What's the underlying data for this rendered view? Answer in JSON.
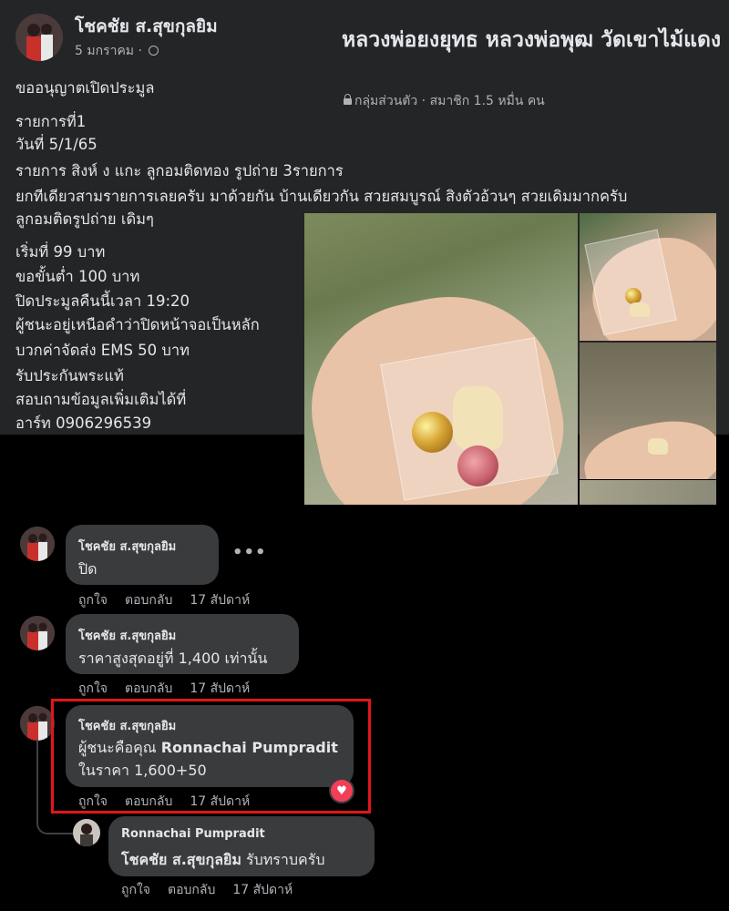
{
  "post": {
    "author": "โชคชัย ส.สุขกุลยิม",
    "date": "5 มกราคม",
    "date_separator": " · ",
    "group": {
      "name": "หลวงพ่อยงยุทธ หลวงพ่อพุฒ วัดเขาไม้แดง",
      "meta": "กลุ่มส่วนตัว · สมาชิก 1.5 หมื่น คน"
    },
    "lines": [
      "ขออนุญาตเปิดประมูล",
      "รายการที่1",
      "วันที่ 5/1/65",
      "รายการ สิงห์ ง แกะ ลูกอมติดทอง รูปถ่าย 3รายการ",
      "ยกทีเดียวสามรายการเลยครับ มาด้วยกัน บ้านเดียวกัน สวยสมบูรณ์ สิงตัวอ้วนๆ สวยเดิมมากครับ",
      "ลูกอมติดรูปถ่าย เดิมๆ",
      "เริ่มที่ 99 บาท",
      "ขอขั้นต่ำ 100 บาท",
      "ปิดประมูลคืนนี้เวลา 19:20",
      "ผู้ชนะอยู่เหนือคำว่าปิดหน้าจอเป็นหลัก",
      "บวกค่าจัดส่ง EMS 50 บาท",
      "รับประกันพระแท้",
      "สอบถามข้อมูลเพิ่มเติมได้ที่",
      "อาร์ท 0906296539"
    ]
  },
  "comments": [
    {
      "name": "โชคชัย ส.สุขกุลยิม",
      "text": "ปิด",
      "like": "ถูกใจ",
      "reply": "ตอบกลับ",
      "time": "17 สัปดาห์"
    },
    {
      "name": "โชคชัย ส.สุขกุลยิม",
      "text": "ราคาสูงสุดอยู่ที่ 1,400 เท่านั้น",
      "like": "ถูกใจ",
      "reply": "ตอบกลับ",
      "time": "17 สัปดาห์"
    },
    {
      "name": "โชคชัย ส.สุขกุลยิม",
      "text_prefix": "ผู้ชนะคือคุณ ",
      "text_mention": "Ronnachai Pumpradit",
      "text2": "ในราคา 1,600+50",
      "like": "ถูกใจ",
      "reply": "ตอบกลับ",
      "time": "17 สัปดาห์",
      "reaction": "heart"
    },
    {
      "name": "Ronnachai Pumpradit",
      "text_mention": "โชคชัย ส.สุขกุลยิม",
      "text_suffix": " รับทราบครับ",
      "like": "ถูกใจ",
      "reply": "ตอบกลับ",
      "time": "17 สัปดาห์"
    }
  ],
  "colors": {
    "highlight": "#e2151b",
    "reaction": "#f33e58",
    "bubble": "#3a3b3c",
    "post_bg": "#242526"
  },
  "icons": [
    "privacy-globe-icon",
    "lock-icon",
    "more-options-icon",
    "heart-reaction-icon"
  ]
}
